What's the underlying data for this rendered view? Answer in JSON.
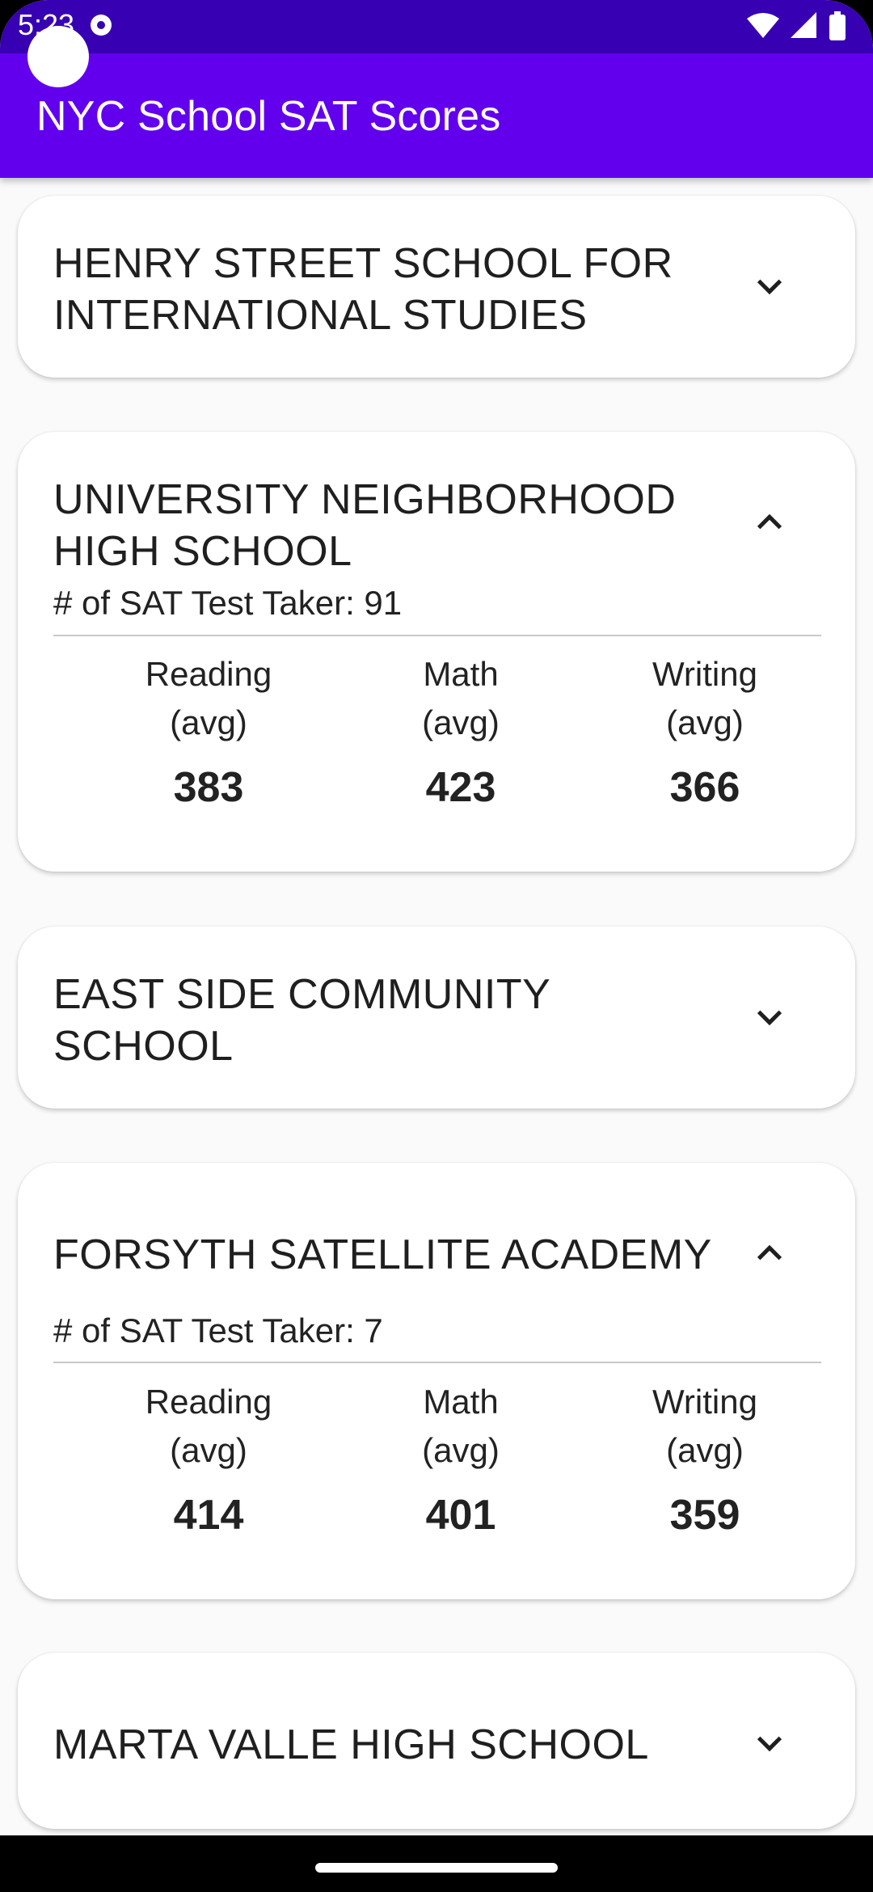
{
  "status_bar": {
    "time": "5:23",
    "icons": [
      "wifi-icon",
      "signal-icon",
      "battery-icon"
    ]
  },
  "app_bar": {
    "title": "NYC School SAT Scores",
    "color": "#6200ee",
    "status_color": "#3700b3"
  },
  "schools": [
    {
      "name": "HENRY STREET SCHOOL FOR INTERNATIONAL STUDIES",
      "expanded": false,
      "icon": "chevron-down-icon"
    },
    {
      "name": "UNIVERSITY NEIGHBORHOOD HIGH SCHOOL",
      "expanded": true,
      "icon": "chevron-up-icon",
      "takers": "# of SAT Test Taker: 91",
      "reading_label": "Reading\n(avg)",
      "math_label": "Math\n(avg)",
      "writing_label": "Writing\n(avg)",
      "reading": "383",
      "math": "423",
      "writing": "366"
    },
    {
      "name": "EAST SIDE COMMUNITY SCHOOL",
      "expanded": false,
      "icon": "chevron-down-icon"
    },
    {
      "name": "FORSYTH SATELLITE ACADEMY",
      "expanded": true,
      "icon": "chevron-up-icon",
      "takers": "# of SAT Test Taker: 7",
      "reading_label": "Reading\n(avg)",
      "math_label": "Math\n(avg)",
      "writing_label": "Writing\n(avg)",
      "reading": "414",
      "math": "401",
      "writing": "359"
    },
    {
      "name": "MARTA VALLE HIGH SCHOOL",
      "expanded": false,
      "icon": "chevron-down-icon"
    }
  ]
}
